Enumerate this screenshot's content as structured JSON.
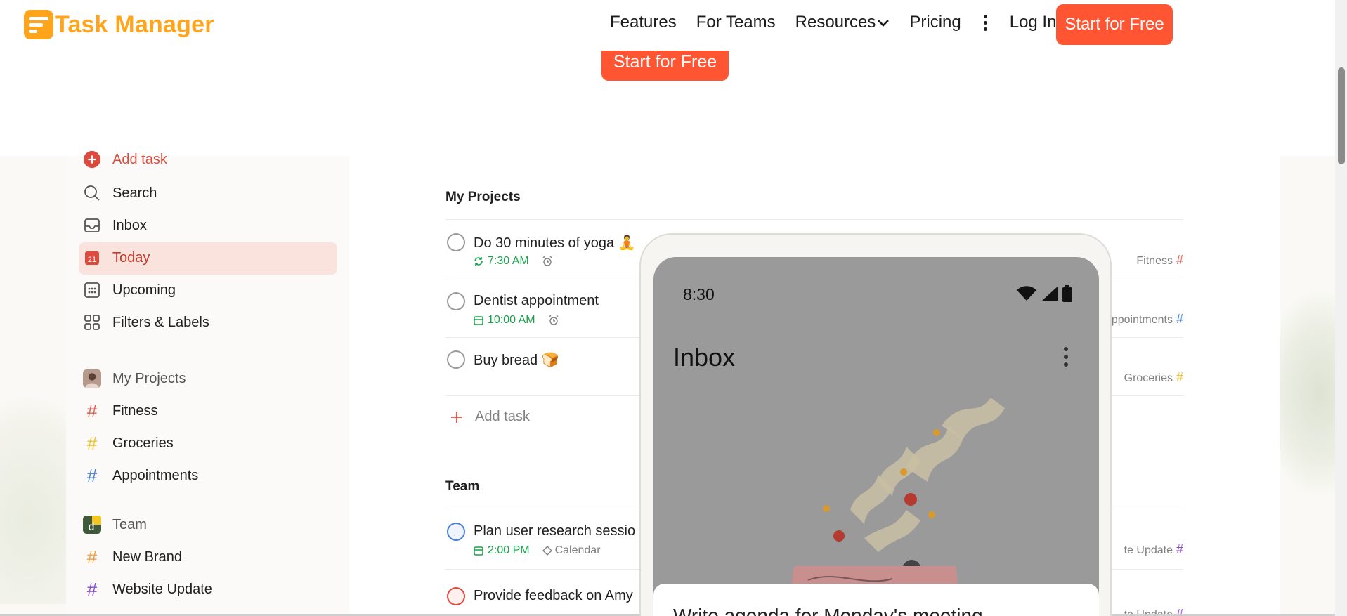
{
  "brand": {
    "name": "Task Manager",
    "color": "#ffa41b",
    "accent": "#ff5533"
  },
  "nav": {
    "items": [
      "Features",
      "For Teams",
      "Resources",
      "Pricing"
    ],
    "login": "Log In",
    "cta": "Start for Free"
  },
  "hero": {
    "cta": "Start for Free"
  },
  "sidebar": {
    "add_task": "Add task",
    "search": "Search",
    "inbox": "Inbox",
    "today": "Today",
    "today_date": "21",
    "upcoming": "Upcoming",
    "filters": "Filters & Labels",
    "my_projects": "My Projects",
    "projects": [
      {
        "name": "Fitness",
        "color": "#e05a4e"
      },
      {
        "name": "Groceries",
        "color": "#f2c029"
      },
      {
        "name": "Appointments",
        "color": "#4a7fd8"
      }
    ],
    "team": "Team",
    "team_projects": [
      {
        "name": "New Brand",
        "color": "#f29f3a"
      },
      {
        "name": "Website Update",
        "color": "#8a4fd8"
      }
    ]
  },
  "main": {
    "my_projects_title": "My Projects",
    "tasks": [
      {
        "title": "Do 30 minutes of yoga 🧘",
        "time": "7:30 AM",
        "project": "Fitness",
        "project_color": "#e05a4e"
      },
      {
        "title": "Dentist appointment",
        "time": "10:00 AM",
        "project": "ppointments",
        "project_color": "#4a7fd8"
      },
      {
        "title": "Buy bread 🍞",
        "project": "Groceries",
        "project_color": "#f2c029"
      }
    ],
    "add_task": "Add task",
    "team_title": "Team",
    "team_tasks": [
      {
        "title": "Plan user research sessio",
        "time": "2:00 PM",
        "label": "Calendar",
        "project": "te Update",
        "project_color": "#8a4fd8"
      },
      {
        "title": "Provide feedback on Amy",
        "project": "te Update",
        "project_color": "#8a4fd8"
      }
    ]
  },
  "phone": {
    "time": "8:30",
    "title": "Inbox",
    "sheet_text": "Write agenda for Monday's meeting"
  }
}
